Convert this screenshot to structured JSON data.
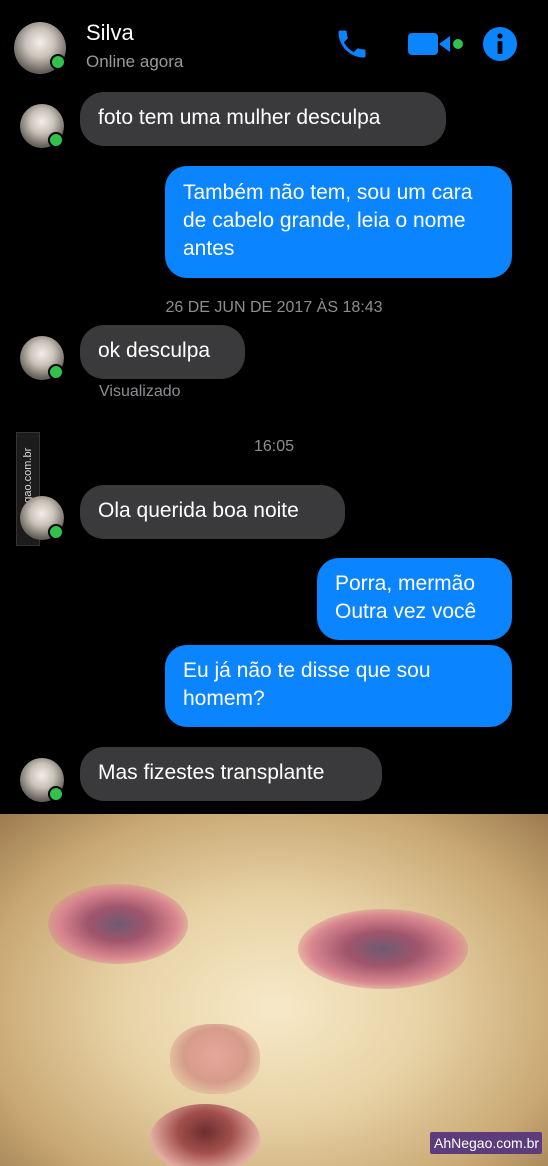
{
  "header": {
    "contact_name": "Silva",
    "status": "Online agora",
    "icons": [
      "phone-icon",
      "video-icon",
      "info-icon"
    ]
  },
  "messages": [
    {
      "side": "in",
      "text": "foto tem uma mulher desculpa"
    },
    {
      "side": "out",
      "text": "Também não tem, sou um cara de cabelo grande, leia o nome antes"
    },
    {
      "type": "timestamp",
      "text": "26 DE JUN DE 2017 ÀS 18:43"
    },
    {
      "side": "in",
      "text": "ok desculpa"
    },
    {
      "type": "seen",
      "text": "Visualizado"
    },
    {
      "type": "timestamp",
      "text": "16:05"
    },
    {
      "side": "in",
      "text": "Ola querida boa noite"
    },
    {
      "side": "out",
      "text": "Porra, mermão Outra vez você"
    },
    {
      "side": "out",
      "text": "Eu já não te disse que sou homem?"
    },
    {
      "side": "in",
      "text": "Mas fizestes transplante"
    }
  ],
  "watermark_side": "AhNegao.com.br",
  "watermark_badge": "AhNegao.com.br",
  "colors": {
    "background": "#000000",
    "incoming_bubble": "#3a3a3c",
    "outgoing_bubble": "#0a84ff",
    "online_dot": "#31c24d",
    "accent_icons": "#0a84ff"
  }
}
